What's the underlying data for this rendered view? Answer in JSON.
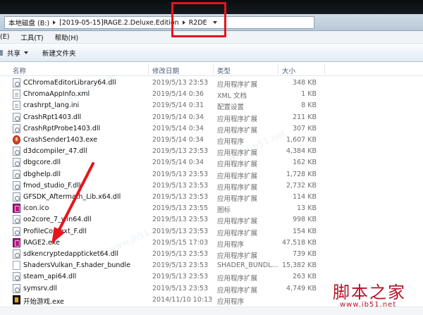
{
  "address": {
    "crumbs": [
      "本地磁盘 (B:)",
      "[2019-05-15]RAGE.2.Deluxe.Edition",
      "R2DE"
    ]
  },
  "menu": {
    "items": [
      "(E)",
      "工具(T)",
      "帮助(H)"
    ]
  },
  "toolbar": {
    "share_label": "共享",
    "new_folder_label": "新建文件夹"
  },
  "columns": {
    "name": "名称",
    "date": "修改日期",
    "type": "类型",
    "size": "大小"
  },
  "files": [
    {
      "name": "CChromaEditorLibrary64.dll",
      "date": "2019/5/13 23:53",
      "type": "应用程序扩展",
      "size": "348 KB",
      "icon": "dll"
    },
    {
      "name": "ChromaAppInfo.xml",
      "date": "2019/5/14 0:36",
      "type": "XML 文档",
      "size": "1 KB",
      "icon": "xml"
    },
    {
      "name": "crashrpt_lang.ini",
      "date": "2019/5/14 0:31",
      "type": "配置设置",
      "size": "8 KB",
      "icon": "ini"
    },
    {
      "name": "CrashRpt1403.dll",
      "date": "2019/5/14 0:34",
      "type": "应用程序扩展",
      "size": "211 KB",
      "icon": "dll"
    },
    {
      "name": "CrashRptProbe1403.dll",
      "date": "2019/5/14 0:34",
      "type": "应用程序扩展",
      "size": "307 KB",
      "icon": "dll"
    },
    {
      "name": "CrashSender1403.exe",
      "date": "2019/5/14 0:34",
      "type": "应用程序",
      "size": "1,607 KB",
      "icon": "crash"
    },
    {
      "name": "d3dcompiler_47.dll",
      "date": "2019/5/13 23:53",
      "type": "应用程序扩展",
      "size": "4,384 KB",
      "icon": "dll"
    },
    {
      "name": "dbgcore.dll",
      "date": "2019/5/14 0:34",
      "type": "应用程序扩展",
      "size": "162 KB",
      "icon": "dll"
    },
    {
      "name": "dbghelp.dll",
      "date": "2019/5/13 23:53",
      "type": "应用程序扩展",
      "size": "1,728 KB",
      "icon": "dll"
    },
    {
      "name": "fmod_studio_F.dll",
      "date": "2019/5/13 23:53",
      "type": "应用程序扩展",
      "size": "2,732 KB",
      "icon": "dll"
    },
    {
      "name": "GFSDK_Aftermath_Lib.x64.dll",
      "date": "2019/5/13 23:53",
      "type": "应用程序扩展",
      "size": "114 KB",
      "icon": "dll"
    },
    {
      "name": "icon.ico",
      "date": "2019/5/13 23:55",
      "type": "图标",
      "size": "13 KB",
      "icon": "ico"
    },
    {
      "name": "oo2core_7_win64.dll",
      "date": "2019/5/13 23:53",
      "type": "应用程序扩展",
      "size": "998 KB",
      "icon": "dll"
    },
    {
      "name": "ProfileContext_F.dll",
      "date": "2019/5/13 23:53",
      "type": "应用程序扩展",
      "size": "154 KB",
      "icon": "dll"
    },
    {
      "name": "RAGE2.exe",
      "date": "2019/5/15 17:03",
      "type": "应用程序",
      "size": "47,518 KB",
      "icon": "rage"
    },
    {
      "name": "sdkencryptedappticket64.dll",
      "date": "2019/5/13 23:53",
      "type": "应用程序扩展",
      "size": "739 KB",
      "icon": "dll"
    },
    {
      "name": "ShadersVulkan_F.shader_bundle",
      "date": "2019/5/13 23:53",
      "type": "SHADER_BUNDL...",
      "size": "15,382 KB",
      "icon": "bundle"
    },
    {
      "name": "steam_api64.dll",
      "date": "2019/5/13 23:53",
      "type": "应用程序扩展",
      "size": "263 KB",
      "icon": "dll"
    },
    {
      "name": "symsrv.dll",
      "date": "2019/5/13 23:53",
      "type": "应用程序扩展",
      "size": "4,749 KB",
      "icon": "dll"
    },
    {
      "name": "开始游戏.exe",
      "date": "2014/11/10 10:13",
      "type": "应用程序",
      "size": "",
      "icon": "game"
    }
  ],
  "watermark": {
    "brand": "脚本之家",
    "url": "www.jb51.net"
  },
  "colors": {
    "highlight": "#e8141c",
    "brand": "#b2132a",
    "rage_icon": "#b21885"
  }
}
